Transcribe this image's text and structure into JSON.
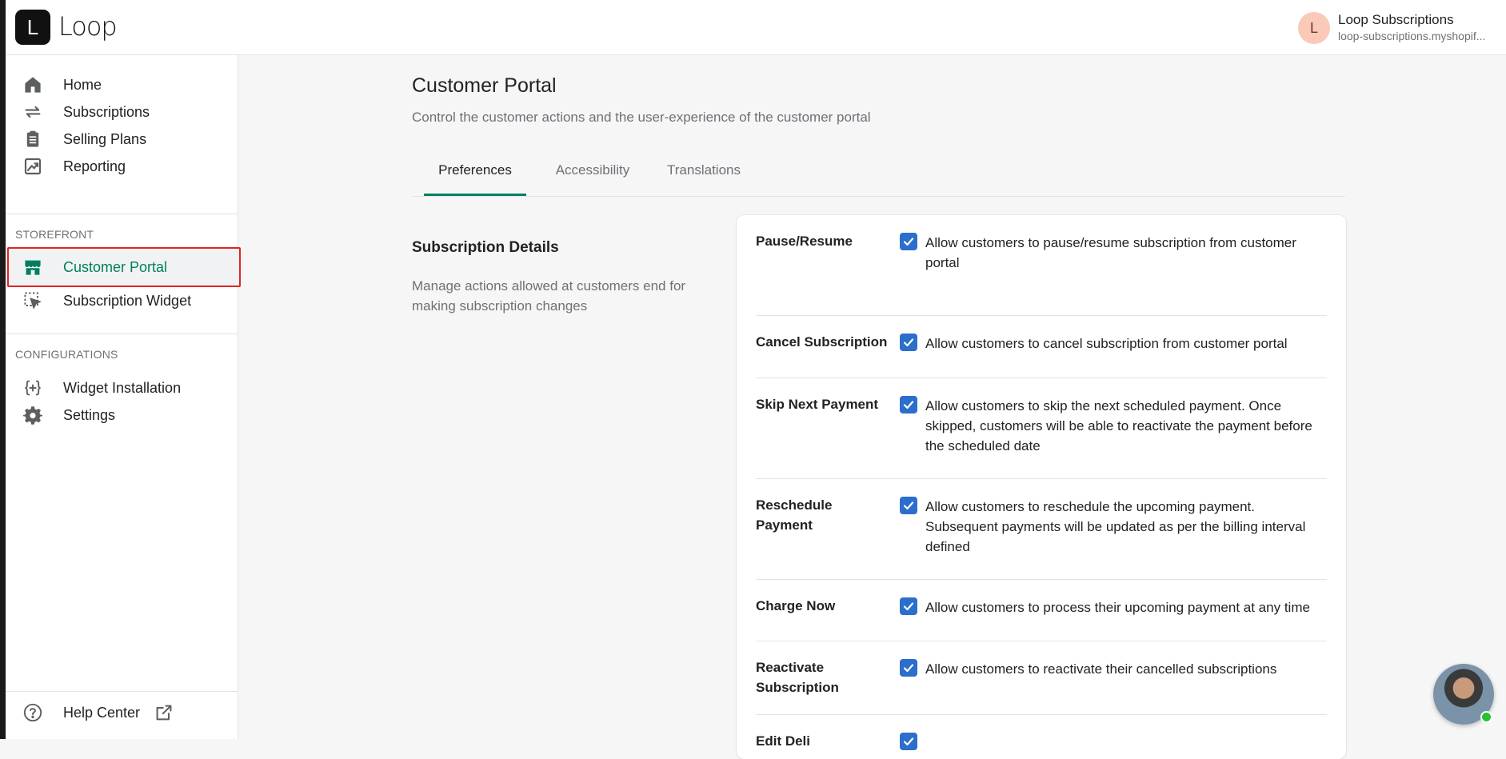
{
  "app": {
    "logo_letter": "L",
    "logo_word": "Loop"
  },
  "store": {
    "avatar_letter": "L",
    "name": "Loop Subscriptions",
    "domain": "loop-subscriptions.myshopif..."
  },
  "sidebar": {
    "items": [
      {
        "label": "Home",
        "icon": "home-icon"
      },
      {
        "label": "Subscriptions",
        "icon": "repeat-icon"
      },
      {
        "label": "Selling Plans",
        "icon": "clipboard-icon"
      },
      {
        "label": "Reporting",
        "icon": "chart-icon"
      }
    ],
    "storefront_title": "STOREFRONT",
    "storefront_items": [
      {
        "label": "Customer Portal",
        "icon": "store-icon",
        "active": true
      },
      {
        "label": "Subscription Widget",
        "icon": "widget-icon"
      }
    ],
    "config_title": "CONFIGURATIONS",
    "config_items": [
      {
        "label": "Widget Installation",
        "icon": "code-icon"
      },
      {
        "label": "Settings",
        "icon": "gear-icon"
      }
    ],
    "help": {
      "label": "Help Center",
      "icon": "question-icon"
    }
  },
  "page": {
    "title": "Customer Portal",
    "subtitle": "Control the customer actions and the user-experience of the customer portal",
    "tabs": [
      {
        "label": "Preferences",
        "active": true
      },
      {
        "label": "Accessibility"
      },
      {
        "label": "Translations"
      }
    ]
  },
  "section": {
    "heading": "Subscription Details",
    "description": "Manage actions allowed at customers end for making subscription changes"
  },
  "settings": [
    {
      "label": "Pause/Resume",
      "checked": true,
      "text": "Allow customers to pause/resume subscription from customer portal"
    },
    {
      "label": "Cancel Subscription",
      "checked": true,
      "text": "Allow customers to cancel subscription from customer portal"
    },
    {
      "label": "Skip Next Payment",
      "checked": true,
      "text": "Allow customers to skip the next scheduled payment. Once skipped, customers will be able to reactivate the payment before the scheduled date"
    },
    {
      "label": "Reschedule Payment",
      "checked": true,
      "text": "Allow customers to reschedule the upcoming payment. Subsequent payments will be updated as per the billing interval defined"
    },
    {
      "label": "Charge Now",
      "checked": true,
      "text": "Allow customers to process their upcoming payment at any time"
    },
    {
      "label": "Reactivate Subscription",
      "checked": true,
      "text": "Allow customers to reactivate their cancelled subscriptions"
    },
    {
      "label": "Edit Deli",
      "checked": true,
      "text": ""
    }
  ],
  "colors": {
    "accent": "#008060",
    "checkbox": "#2c6ecb",
    "highlight": "#e02424"
  }
}
